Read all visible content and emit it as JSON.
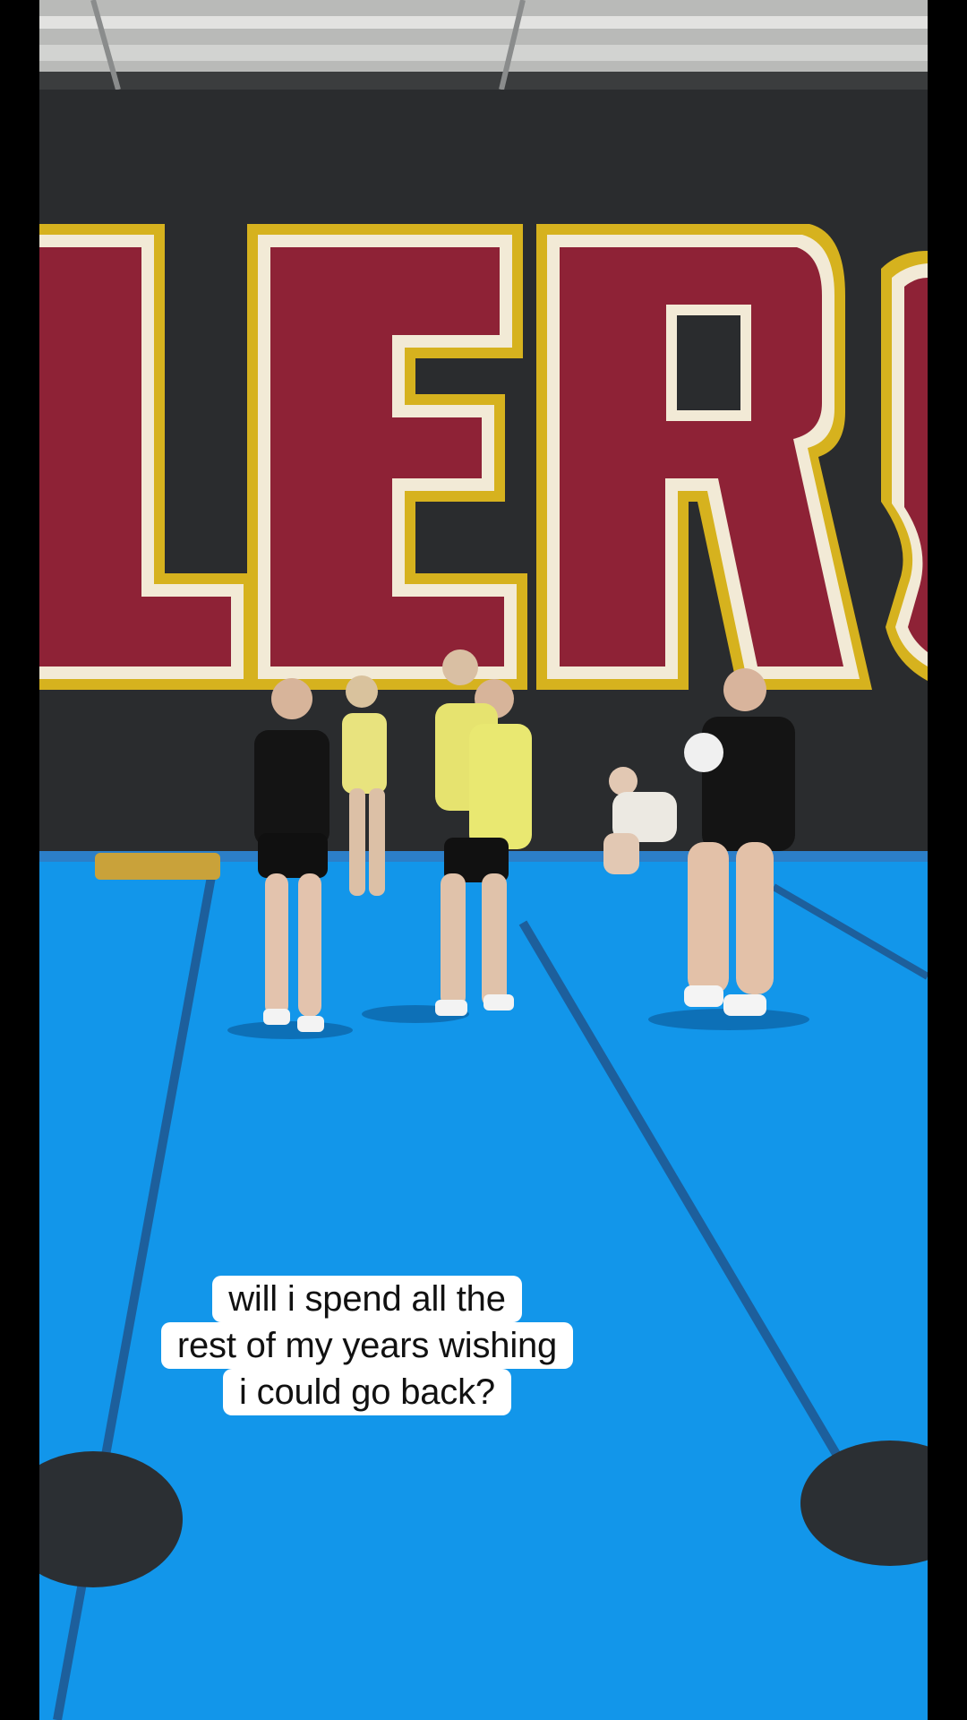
{
  "video": {
    "wall_lettering": "LERS",
    "colors": {
      "wall": "#2a2c2e",
      "letter_fill": "#8e2236",
      "letter_outline_gold": "#d6b21e",
      "letter_outline_white": "#f2ead6",
      "floor": "#1296ea",
      "floor_line": "#1d5f9c",
      "ceiling": "#c9c9c7"
    }
  },
  "caption": {
    "lines": [
      "will i spend all the",
      "rest of my years wishing",
      "i could go back?"
    ]
  }
}
